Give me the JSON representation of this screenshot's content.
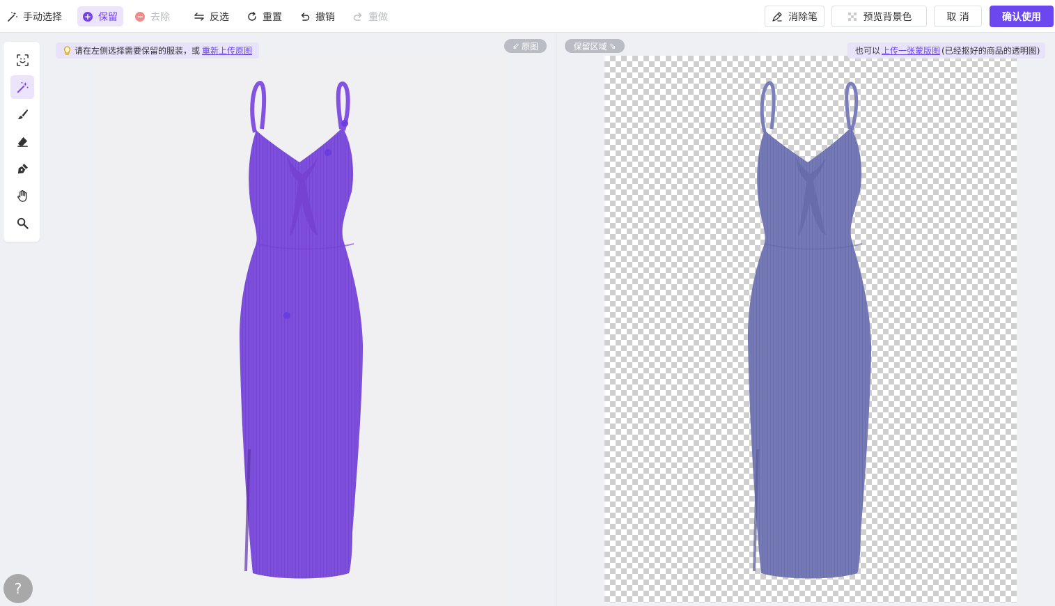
{
  "toolbar": {
    "manual_select": "手动选择",
    "keep": "保留",
    "remove": "去除",
    "invert": "反选",
    "reset": "重置",
    "undo": "撤销",
    "redo": "重做",
    "eraser_pen": "消除笔",
    "preview_bg": "预览背景色",
    "cancel": "取 消",
    "confirm": "确认使用"
  },
  "left_panel": {
    "hint_text": "请在左侧选择需要保留的服装，或",
    "hint_link": "重新上传原图",
    "original_tag": "原图"
  },
  "right_panel": {
    "keep_area_tag": "保留区域",
    "hint_prefix": "也可以",
    "hint_link": "上传一张蒙版图",
    "hint_suffix": "(已经抠好的商品的透明图)"
  },
  "help": {
    "label": "?"
  },
  "colors": {
    "accent": "#6c47f0",
    "keep_bg": "#ece4fd",
    "mask_purple": "#7e4fdc",
    "cutout_blue": "#7378b3"
  },
  "palette": [
    "scan-icon",
    "magic-wand-icon",
    "brush-icon",
    "eraser-icon",
    "pen-icon",
    "hand-icon",
    "zoom-icon"
  ]
}
